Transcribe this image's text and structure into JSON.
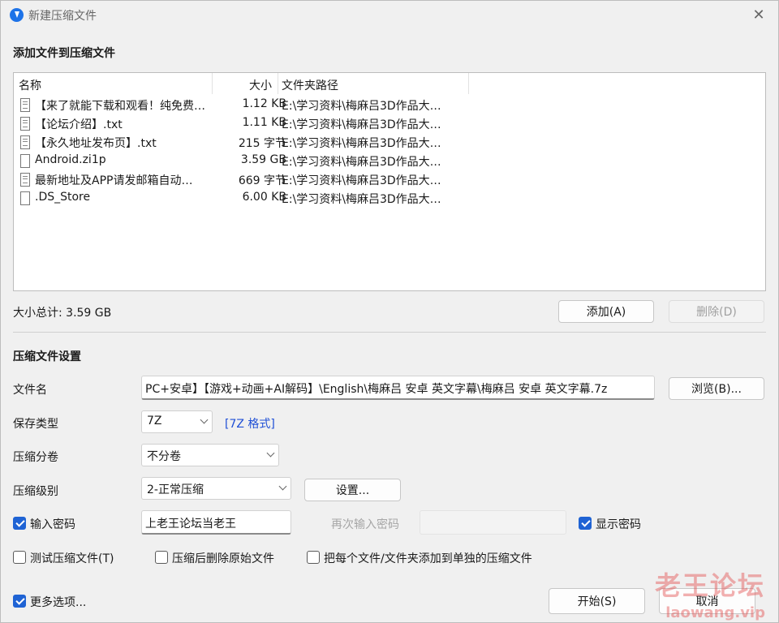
{
  "window": {
    "title": "新建压缩文件",
    "close_glyph": "✕"
  },
  "files_section": {
    "title": "添加文件到压缩文件"
  },
  "file_list": {
    "columns": [
      "名称",
      "大小",
      "文件夹路径"
    ],
    "rows": [
      {
        "icon": "text-file-icon",
        "name": "【来了就能下载和观看！纯免费…",
        "size": "1.12 KB",
        "path": "E:\\学习资料\\梅麻吕3D作品大…"
      },
      {
        "icon": "text-file-icon",
        "name": "【论坛介绍】.txt",
        "size": "1.11 KB",
        "path": "E:\\学习资料\\梅麻吕3D作品大…"
      },
      {
        "icon": "text-file-icon",
        "name": "【永久地址发布页】.txt",
        "size": "215 字节",
        "path": "E:\\学习资料\\梅麻吕3D作品大…"
      },
      {
        "icon": "file-icon",
        "name": "Android.zi1p",
        "size": "3.59 GB",
        "path": "E:\\学习资料\\梅麻吕3D作品大…"
      },
      {
        "icon": "text-file-icon",
        "name": "最新地址及APP请发邮箱自动…",
        "size": "669 字节",
        "path": "E:\\学习资料\\梅麻吕3D作品大…"
      },
      {
        "icon": "file-icon",
        "name": ".DS_Store",
        "size": "6.00 KB",
        "path": "E:\\学习资料\\梅麻吕3D作品大…"
      }
    ]
  },
  "total_size": "大小总计: 3.59 GB",
  "buttons": {
    "add": "添加(A)",
    "remove": "删除(D)",
    "browse": "浏览(B)...",
    "settings": "设置...",
    "start": "开始(S)",
    "cancel": "取消"
  },
  "settings_section": {
    "title": "压缩文件设置"
  },
  "form": {
    "filename_label": "文件名",
    "filename_value": "PC+安卓】【游戏+动画+AI解码】\\English\\梅麻吕 安卓 英文字幕\\梅麻吕 安卓 英文字幕.7z",
    "save_type_label": "保存类型",
    "save_type_value": "7Z",
    "format_link": "[7Z 格式]",
    "split_label": "压缩分卷",
    "split_value": "不分卷",
    "level_label": "压缩级别",
    "level_value": "2-正常压缩",
    "password_label": "输入密码",
    "password_value": "上老王论坛当老王",
    "password_checked": true,
    "repeat_password_label": "再次输入密码",
    "show_password_label": "显示密码",
    "show_password_checked": true
  },
  "options": {
    "test_label": "测试压缩文件(T)",
    "test_checked": false,
    "delete_label": "压缩后删除原始文件",
    "delete_checked": false,
    "separate_label": "把每个文件/文件夹添加到单独的压缩文件",
    "separate_checked": false,
    "more_label": "更多选项...",
    "more_checked": true
  },
  "watermark": {
    "text": "老王论坛",
    "url": "laowang.vip"
  },
  "colors": {
    "accent": "#1f63d4",
    "link": "#1f4fd6",
    "app_icon": "#1e73e8"
  }
}
